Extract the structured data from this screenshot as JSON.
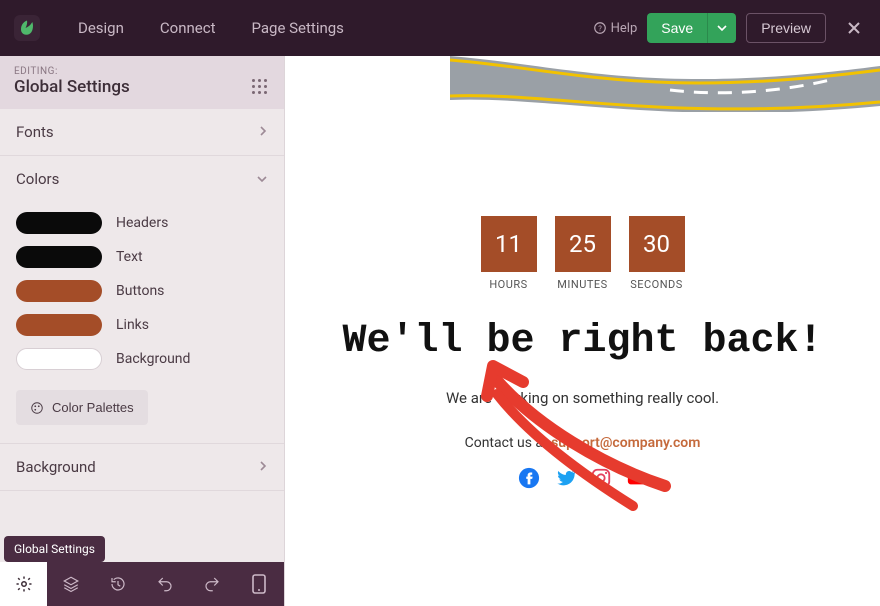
{
  "topbar": {
    "nav": {
      "design": "Design",
      "connect": "Connect",
      "page_settings": "Page Settings"
    },
    "help": "Help",
    "save": "Save",
    "preview": "Preview"
  },
  "panel": {
    "editing_label": "EDITING:",
    "title": "Global Settings"
  },
  "accordion": {
    "fonts": "Fonts",
    "colors": "Colors",
    "background": "Background"
  },
  "colors": {
    "items": [
      {
        "label": "Headers",
        "value": "#0a0a0a"
      },
      {
        "label": "Text",
        "value": "#0a0a0a"
      },
      {
        "label": "Buttons",
        "value": "#a44d28"
      },
      {
        "label": "Links",
        "value": "#a44d28"
      },
      {
        "label": "Background",
        "value": "#ffffff"
      }
    ],
    "palettes_button": "Color Palettes"
  },
  "footer": {
    "tooltip": "Global Settings"
  },
  "page": {
    "countdown": {
      "hours_value": "11",
      "hours_label": "HOURS",
      "minutes_value": "25",
      "minutes_label": "MINUTES",
      "seconds_value": "30",
      "seconds_label": "SECONDS"
    },
    "heading": "We'll be right back!",
    "subtext": "We are working on something really cool.",
    "contact_prefix": "Contact us at ",
    "contact_email": "support@company.com"
  }
}
